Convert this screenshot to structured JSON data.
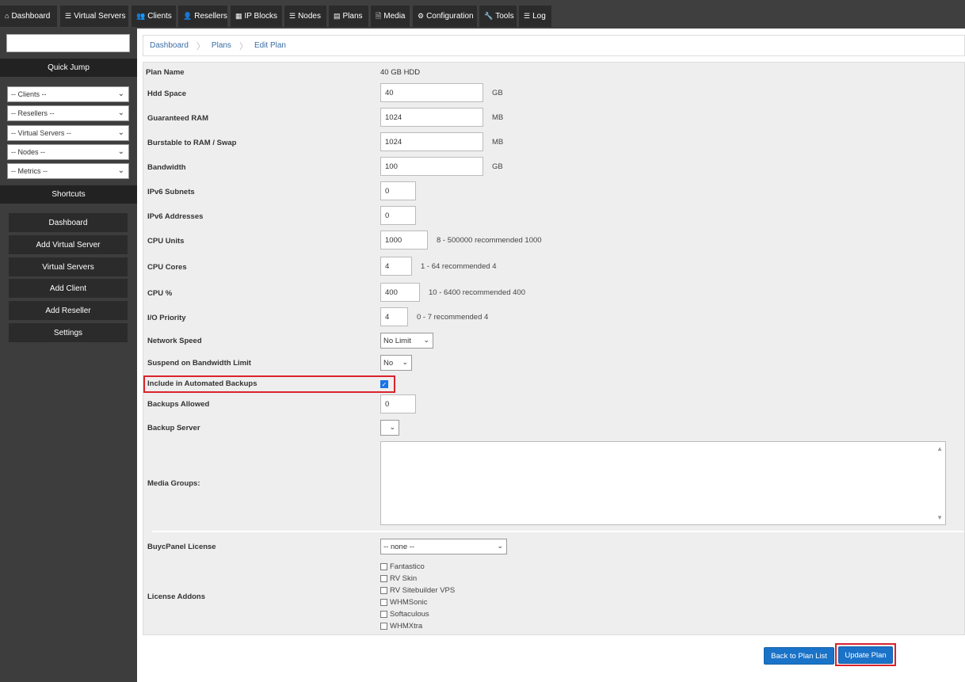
{
  "nav": {
    "items": [
      {
        "label": "Dashboard",
        "icon": "home-icon",
        "glyph": "⌂"
      },
      {
        "label": "Virtual Servers",
        "icon": "server-icon",
        "glyph": "☰"
      },
      {
        "label": "Clients",
        "icon": "users-icon",
        "glyph": "👥"
      },
      {
        "label": "Resellers",
        "icon": "user-icon",
        "glyph": "👤"
      },
      {
        "label": "IP Blocks",
        "icon": "grid-icon",
        "glyph": "▦"
      },
      {
        "label": "Nodes",
        "icon": "list-icon",
        "glyph": "☰"
      },
      {
        "label": "Plans",
        "icon": "card-icon",
        "glyph": "▤"
      },
      {
        "label": "Media",
        "icon": "file-icon",
        "glyph": "🗎"
      },
      {
        "label": "Configuration",
        "icon": "gear-icon",
        "glyph": "⚙"
      },
      {
        "label": "Tools",
        "icon": "wrench-icon",
        "glyph": "🔧"
      },
      {
        "label": "Log",
        "icon": "list-icon",
        "glyph": "☰"
      }
    ]
  },
  "sidebar": {
    "search": {
      "value": ""
    },
    "quick_jump": "Quick Jump",
    "selects": [
      "-- Clients --",
      "-- Resellers --",
      "-- Virtual Servers --",
      "-- Nodes --",
      "-- Metrics --"
    ],
    "shortcuts": "Shortcuts",
    "buttons": [
      "Dashboard",
      "Add Virtual Server",
      "Virtual Servers",
      "Add Client",
      "Add Reseller",
      "Settings"
    ]
  },
  "breadcrumb": [
    "Dashboard",
    "Plans",
    "Edit Plan"
  ],
  "form": {
    "plan_name": {
      "label": "Plan Name",
      "value": "40 GB HDD"
    },
    "hdd_space": {
      "label": "Hdd Space",
      "value": "40",
      "unit": "GB"
    },
    "guaranteed_ram": {
      "label": "Guaranteed RAM",
      "value": "1024",
      "unit": "MB"
    },
    "burstable_ram": {
      "label": "Burstable to RAM / Swap",
      "value": "1024",
      "unit": "MB"
    },
    "bandwidth": {
      "label": "Bandwidth",
      "value": "100",
      "unit": "GB"
    },
    "ipv6_subnets": {
      "label": "IPv6 Subnets",
      "value": "0"
    },
    "ipv6_addresses": {
      "label": "IPv6 Addresses",
      "value": "0"
    },
    "cpu_units": {
      "label": "CPU Units",
      "value": "1000",
      "hint": "8 - 500000 recommended 1000"
    },
    "cpu_cores": {
      "label": "CPU Cores",
      "value": "4",
      "hint": "1 - 64 recommended 4"
    },
    "cpu_percent": {
      "label": "CPU %",
      "value": "400",
      "hint": "10 - 6400 recommended 400"
    },
    "io_priority": {
      "label": "I/O Priority",
      "value": "4",
      "hint": "0 - 7 recommended 4"
    },
    "network_speed": {
      "label": "Network Speed",
      "value": "No Limit"
    },
    "suspend_bw": {
      "label": "Suspend on Bandwidth Limit",
      "value": "No"
    },
    "auto_backups": {
      "label": "Include in Automated Backups",
      "checked": true
    },
    "backups_allowed": {
      "label": "Backups Allowed",
      "value": "0"
    },
    "backup_server": {
      "label": "Backup Server",
      "value": ""
    },
    "media_groups": {
      "label": "Media Groups:"
    },
    "buycpanel": {
      "label": "BuycPanel License",
      "value": "-- none --"
    },
    "license_addons": {
      "label": "License Addons",
      "items": [
        "Fantastico",
        "RV Skin",
        "RV Sitebuilder VPS",
        "WHMSonic",
        "Softaculous",
        "WHMXtra"
      ]
    }
  },
  "actions": {
    "back": "Back to Plan List",
    "update": "Update Plan"
  },
  "colors": {
    "accent": "#1a73c8",
    "highlight": "#d9232e",
    "nav_bg": "#2b2b2b"
  }
}
